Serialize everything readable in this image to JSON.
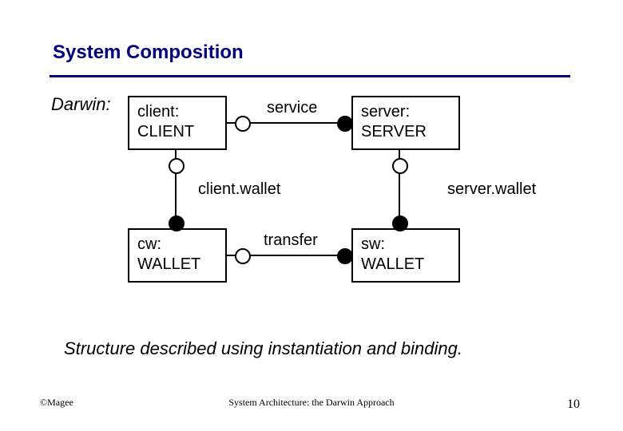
{
  "title": "System Composition",
  "darwin_label": "Darwin:",
  "boxes": {
    "client": {
      "line1": "client:",
      "line2": "CLIENT"
    },
    "server": {
      "line1": "server:",
      "line2": "SERVER"
    },
    "cw": {
      "line1": "cw:",
      "line2": "WALLET"
    },
    "sw": {
      "line1": "sw:",
      "line2": "WALLET"
    }
  },
  "edges": {
    "service": "service",
    "transfer": "transfer",
    "client_wallet": "client.wallet",
    "server_wallet": "server.wallet"
  },
  "caption": "Structure described using instantiation and binding.",
  "footer": {
    "left": "©Magee",
    "center": "System Architecture: the Darwin Approach",
    "page": "10"
  }
}
